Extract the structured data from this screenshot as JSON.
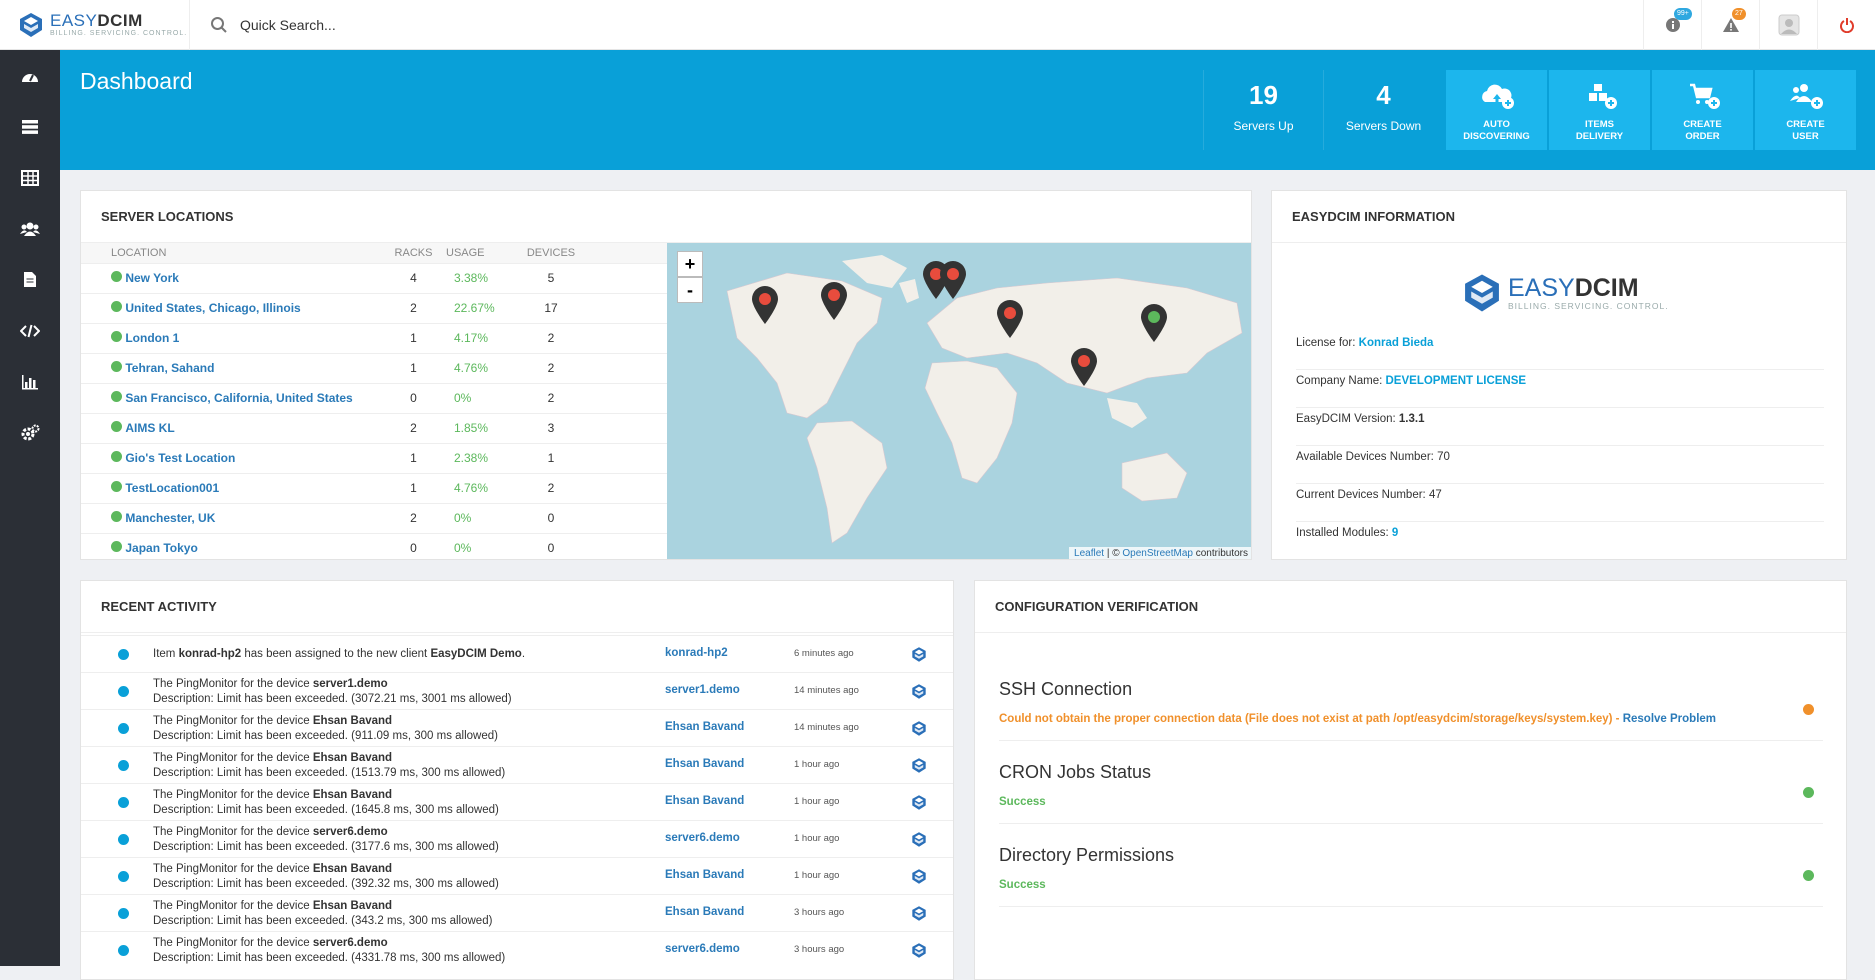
{
  "brand": {
    "name_light": "EASY",
    "name_bold": "DCIM",
    "tagline": "BILLING. SERVICING. CONTROL."
  },
  "search": {
    "placeholder": "Quick Search..."
  },
  "top_icons": [
    {
      "icon": "info-icon",
      "badge": "99+",
      "badge_color": "#2fa8e0"
    },
    {
      "icon": "warning-icon",
      "badge": "27",
      "badge_color": "#f0902b"
    },
    {
      "icon": "user-avatar-icon"
    },
    {
      "icon": "power-icon",
      "color": "#e03c2b"
    }
  ],
  "sidebar": {
    "items": [
      "dashboard-icon",
      "servers-icon",
      "table-icon",
      "users-icon",
      "document-icon",
      "code-icon",
      "chart-icon",
      "settings-icon"
    ]
  },
  "header": {
    "title": "Dashboard",
    "stats": [
      {
        "value": "19",
        "label": "Servers Up"
      },
      {
        "value": "4",
        "label": "Servers Down"
      }
    ],
    "actions": [
      {
        "line1": "AUTO",
        "line2": "DISCOVERING",
        "icon": "cloud-add-icon"
      },
      {
        "line1": "ITEMS",
        "line2": "DELIVERY",
        "icon": "boxes-add-icon"
      },
      {
        "line1": "CREATE",
        "line2": "ORDER",
        "icon": "cart-add-icon"
      },
      {
        "line1": "CREATE",
        "line2": "USER",
        "icon": "users-add-icon"
      }
    ]
  },
  "locations": {
    "title": "SERVER LOCATIONS",
    "columns": [
      "LOCATION",
      "RACKS",
      "USAGE",
      "DEVICES"
    ],
    "rows": [
      {
        "name": "New York",
        "racks": "4",
        "usage": "3.38%",
        "devices": "5"
      },
      {
        "name": "United States, Chicago, Illinois",
        "racks": "2",
        "usage": "22.67%",
        "devices": "17"
      },
      {
        "name": "London 1",
        "racks": "1",
        "usage": "4.17%",
        "devices": "2"
      },
      {
        "name": "Tehran, Sahand",
        "racks": "1",
        "usage": "4.76%",
        "devices": "2"
      },
      {
        "name": "San Francisco, California, United States",
        "racks": "0",
        "usage": "0%",
        "devices": "2"
      },
      {
        "name": "AIMS KL",
        "racks": "2",
        "usage": "1.85%",
        "devices": "3"
      },
      {
        "name": "Gio's Test Location",
        "racks": "1",
        "usage": "2.38%",
        "devices": "1"
      },
      {
        "name": "TestLocation001",
        "racks": "1",
        "usage": "4.76%",
        "devices": "2"
      },
      {
        "name": "Manchester, UK",
        "racks": "2",
        "usage": "0%",
        "devices": "0"
      },
      {
        "name": "Japan Tokyo",
        "racks": "0",
        "usage": "0%",
        "devices": "0"
      }
    ],
    "map": {
      "zoom_in": "+",
      "zoom_out": "-",
      "attr_leaflet": "Leaflet",
      "attr_sep": " | © ",
      "attr_osm": "OpenStreetMap",
      "attr_tail": " contributors"
    }
  },
  "info": {
    "title": "EASYDCIM INFORMATION",
    "license_label": "License for:",
    "license_value": "Konrad Bieda",
    "company_label": "Company Name:",
    "company_value": "DEVELOPMENT LICENSE",
    "version_label": "EasyDCIM Version:",
    "version_value": "1.3.1",
    "available_label": "Available Devices Number:",
    "available_value": "70",
    "current_label": "Current Devices Number:",
    "current_value": "47",
    "modules_label": "Installed Modules:",
    "modules_value": "9"
  },
  "activity": {
    "title": "RECENT ACTIVITY",
    "rows": [
      {
        "type": "assign",
        "pre": "Item ",
        "bold1": "konrad-hp2",
        "mid": " has been assigned to the new client ",
        "bold2": "EasyDCIM Demo",
        "post": ".",
        "link": "konrad-hp2",
        "time": "6 minutes ago"
      },
      {
        "type": "ping",
        "pre": "The PingMonitor for the device ",
        "device": "server1.demo",
        "desc": "Description: Limit has been exceeded. (3072.21 ms, 3001 ms allowed)",
        "link": "server1.demo",
        "time": "14 minutes ago"
      },
      {
        "type": "ping",
        "pre": "The PingMonitor for the device ",
        "device": "Ehsan Bavand",
        "desc": "Description: Limit has been exceeded. (911.09 ms, 300 ms allowed)",
        "link": "Ehsan Bavand",
        "time": "14 minutes ago"
      },
      {
        "type": "ping",
        "pre": "The PingMonitor for the device ",
        "device": "Ehsan Bavand",
        "desc": "Description: Limit has been exceeded. (1513.79 ms, 300 ms allowed)",
        "link": "Ehsan Bavand",
        "time": "1 hour ago"
      },
      {
        "type": "ping",
        "pre": "The PingMonitor for the device ",
        "device": "Ehsan Bavand",
        "desc": "Description: Limit has been exceeded. (1645.8 ms, 300 ms allowed)",
        "link": "Ehsan Bavand",
        "time": "1 hour ago"
      },
      {
        "type": "ping",
        "pre": "The PingMonitor for the device ",
        "device": "server6.demo",
        "desc": "Description: Limit has been exceeded. (3177.6 ms, 300 ms allowed)",
        "link": "server6.demo",
        "time": "1 hour ago"
      },
      {
        "type": "ping",
        "pre": "The PingMonitor for the device ",
        "device": "Ehsan Bavand",
        "desc": "Description: Limit has been exceeded. (392.32 ms, 300 ms allowed)",
        "link": "Ehsan Bavand",
        "time": "1 hour ago"
      },
      {
        "type": "ping",
        "pre": "The PingMonitor for the device ",
        "device": "Ehsan Bavand",
        "desc": "Description: Limit has been exceeded. (343.2 ms, 300 ms allowed)",
        "link": "Ehsan Bavand",
        "time": "3 hours ago"
      },
      {
        "type": "ping",
        "pre": "The PingMonitor for the device ",
        "device": "server6.demo",
        "desc": "Description: Limit has been exceeded. (4331.78 ms, 300 ms allowed)",
        "link": "server6.demo",
        "time": "3 hours ago"
      }
    ]
  },
  "config": {
    "title": "CONFIGURATION VERIFICATION",
    "checks": [
      {
        "name": "SSH Connection",
        "status": "Could not obtain the proper connection data (File does not exist at path /opt/easydcim/storage/keys/system.key)",
        "sep": " - ",
        "action": "Resolve Problem",
        "color": "#f0902b"
      },
      {
        "name": "CRON Jobs Status",
        "status": "Success",
        "color": "#5cb85c"
      },
      {
        "name": "Directory Permissions",
        "status": "Success",
        "color": "#5cb85c"
      }
    ]
  },
  "colors": {
    "accent": "#09a0d8",
    "action_bg": "#1cb6ed",
    "sidebar": "#2b2f36",
    "success": "#5cb85c",
    "warning": "#f0902b",
    "link": "#2a7ab8"
  }
}
